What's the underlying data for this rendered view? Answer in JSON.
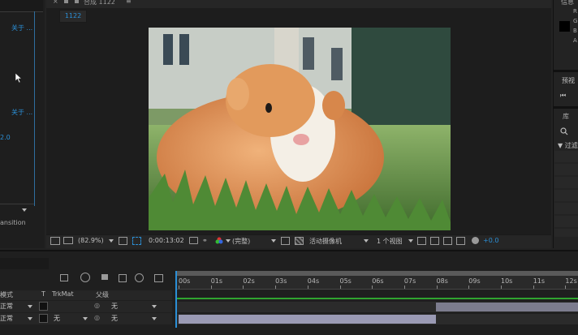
{
  "left_panel": {
    "about_link_1": "关于 ...",
    "about_link_2": "关于 ...",
    "version": "2.0",
    "transition_label": "ansition"
  },
  "comp_tab": {
    "title": "合成 1122",
    "sub_tab": "1122"
  },
  "viewer_toolbar": {
    "zoom": "(82.9%)",
    "timecode": "0:00:13:02",
    "resolution": "(完整)",
    "camera": "活动摄像机",
    "views": "1 个视图",
    "exposure": "+0.0"
  },
  "right_panel": {
    "info_title": "信息",
    "info_chars": [
      "R",
      "G",
      "B",
      "A"
    ],
    "preview_title": "预视",
    "library_title": "库",
    "search_icon": "search-icon",
    "filter_label": "▼ 过滤"
  },
  "timeline": {
    "col_mode": "模式",
    "col_t": "T",
    "col_trkmat": "TrkMat",
    "col_parent": "父级",
    "layers": [
      {
        "mode": "正常",
        "trkmat": "",
        "parent": "无"
      },
      {
        "mode": "正常",
        "trkmat": "无",
        "parent": "无"
      }
    ],
    "ruler": [
      "00s",
      "01s",
      "02s",
      "03s",
      "04s",
      "05s",
      "06s",
      "07s",
      "08s",
      "09s",
      "10s",
      "11s",
      "12s"
    ]
  }
}
